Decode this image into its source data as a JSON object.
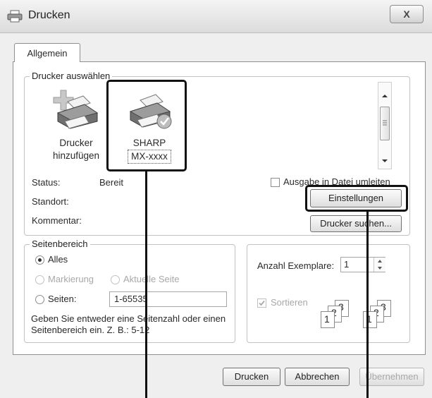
{
  "window": {
    "title": "Drucken",
    "close_symbol": "X"
  },
  "tabs": [
    {
      "label": "Allgemein",
      "active": true
    }
  ],
  "printer_group": {
    "legend": "Drucker auswählen",
    "printers": [
      {
        "line1": "Drucker",
        "line2": "hinzufügen",
        "icon": "add-printer-icon"
      },
      {
        "line1": "SHARP",
        "line2": "MX-xxxx",
        "icon": "printer-default-icon"
      }
    ],
    "status_label": "Status:",
    "status_value": "Bereit",
    "location_label": "Standort:",
    "comment_label": "Kommentar:",
    "print_to_file_label": "Ausgabe in Datei umleiten",
    "settings_button": "Einstellungen",
    "find_printer_button": "Drucker suchen..."
  },
  "page_range": {
    "legend": "Seitenbereich",
    "all_label": "Alles",
    "selection_label": "Markierung",
    "current_page_label": "Aktuelle Seite",
    "pages_label": "Seiten:",
    "pages_value": "1-65535",
    "hint": "Geben Sie entweder eine Seitenzahl oder einen Seitenbereich ein. Z. B.: 5-12"
  },
  "copies": {
    "label": "Anzahl Exemplare:",
    "value": "1",
    "collate_label": "Sortieren",
    "collate_icon_digits": [
      "1",
      "2",
      "3"
    ]
  },
  "footer": {
    "print_button": "Drucken",
    "cancel_button": "Abbrechen",
    "apply_button": "Übernehmen"
  }
}
